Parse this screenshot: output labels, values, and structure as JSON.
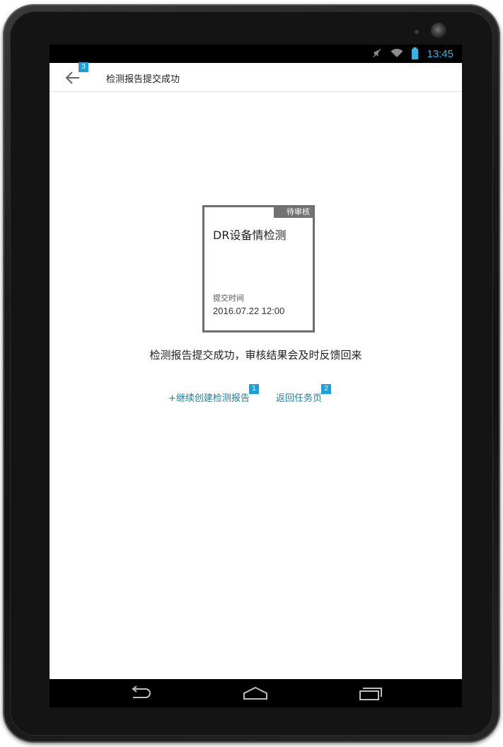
{
  "status_bar": {
    "time": "13:45",
    "icons": [
      "mute-icon",
      "wifi-icon",
      "battery-icon"
    ]
  },
  "header": {
    "title": "检测报告提交成功",
    "back_badge": "3"
  },
  "report_card": {
    "status_flag": "待审核",
    "title": "DR设备情检测",
    "submit_label": "提交时间",
    "submit_time": "2016.07.22 12:00"
  },
  "message": "检测报告提交成功，审核结果会及时反馈回来",
  "actions": {
    "continue_label": "+继续创建检测报告",
    "continue_badge": "1",
    "return_label": "返回任务页",
    "return_badge": "2"
  },
  "navigation": {
    "icons": [
      "back-nav-icon",
      "home-nav-icon",
      "recents-nav-icon"
    ]
  },
  "colors": {
    "accent": "#1f9fd8",
    "link": "#1a7f9c",
    "status_clock": "#33b5e5",
    "card_border": "#6e6e6e"
  }
}
